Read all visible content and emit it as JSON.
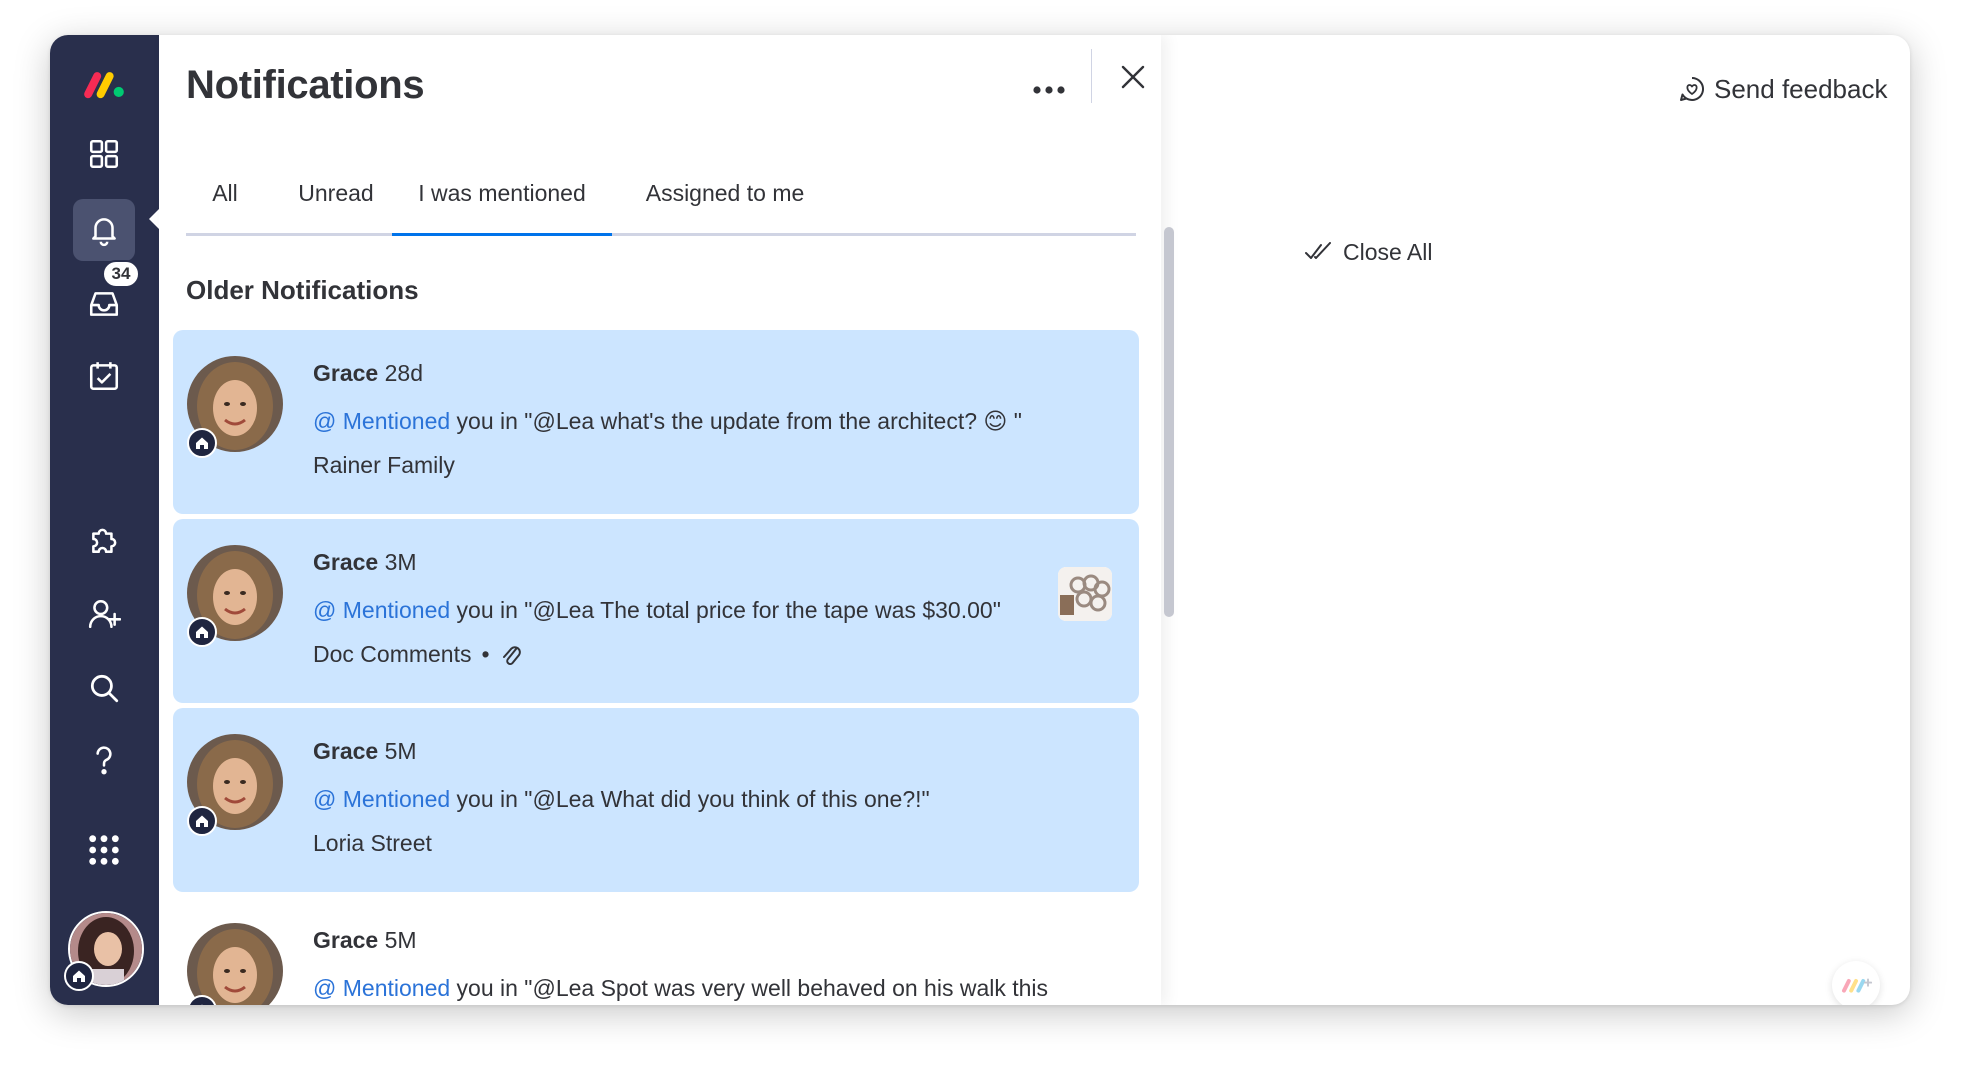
{
  "app": {
    "brand": "monday.com",
    "colors": {
      "rail": "#292f4c",
      "accent": "#0073ea",
      "card_highlight": "#cce5ff",
      "mention": "#2b73d8"
    }
  },
  "rail": {
    "items": [
      {
        "icon": "monday-logo-icon"
      },
      {
        "icon": "grid-icon"
      },
      {
        "icon": "bell-icon",
        "active": true
      },
      {
        "icon": "inbox-icon",
        "badge": "34"
      },
      {
        "icon": "calendar-check-icon"
      },
      {
        "icon": "puzzle-icon"
      },
      {
        "icon": "add-user-icon"
      },
      {
        "icon": "search-icon"
      },
      {
        "icon": "help-icon"
      },
      {
        "icon": "apps-grid-icon"
      }
    ],
    "inbox_badge": "34"
  },
  "panel": {
    "title": "Notifications",
    "tabs": [
      {
        "label": "All"
      },
      {
        "label": "Unread"
      },
      {
        "label": "I was mentioned",
        "active": true
      },
      {
        "label": "Assigned to me"
      }
    ],
    "section_title": "Older Notifications",
    "notifications": [
      {
        "name": "Grace",
        "time": "28d",
        "mention_label": "@ Mentioned",
        "text": "you in \"@Lea what's the update from the architect? 😊 \"",
        "board": "Rainer Family",
        "highlighted": true
      },
      {
        "name": "Grace",
        "time": "3M",
        "mention_label": "@ Mentioned",
        "text": "you in \"@Lea The total price for the tape was $30.00\"",
        "board": "Doc Comments",
        "separator": "•",
        "has_attachment": true,
        "has_thumbnail": true,
        "highlighted": true
      },
      {
        "name": "Grace",
        "time": "5M",
        "mention_label": "@ Mentioned",
        "text": "you in \"@Lea What did you think of this one?!\"",
        "board": "Loria Street",
        "highlighted": true
      },
      {
        "name": "Grace",
        "time": "5M",
        "mention_label": "@ Mentioned",
        "text": "you in \"@Lea Spot was very well behaved on his walk this evening!\"",
        "board": "",
        "highlighted": false
      }
    ]
  },
  "right": {
    "send_feedback": "Send feedback",
    "close_all": "Close All"
  }
}
